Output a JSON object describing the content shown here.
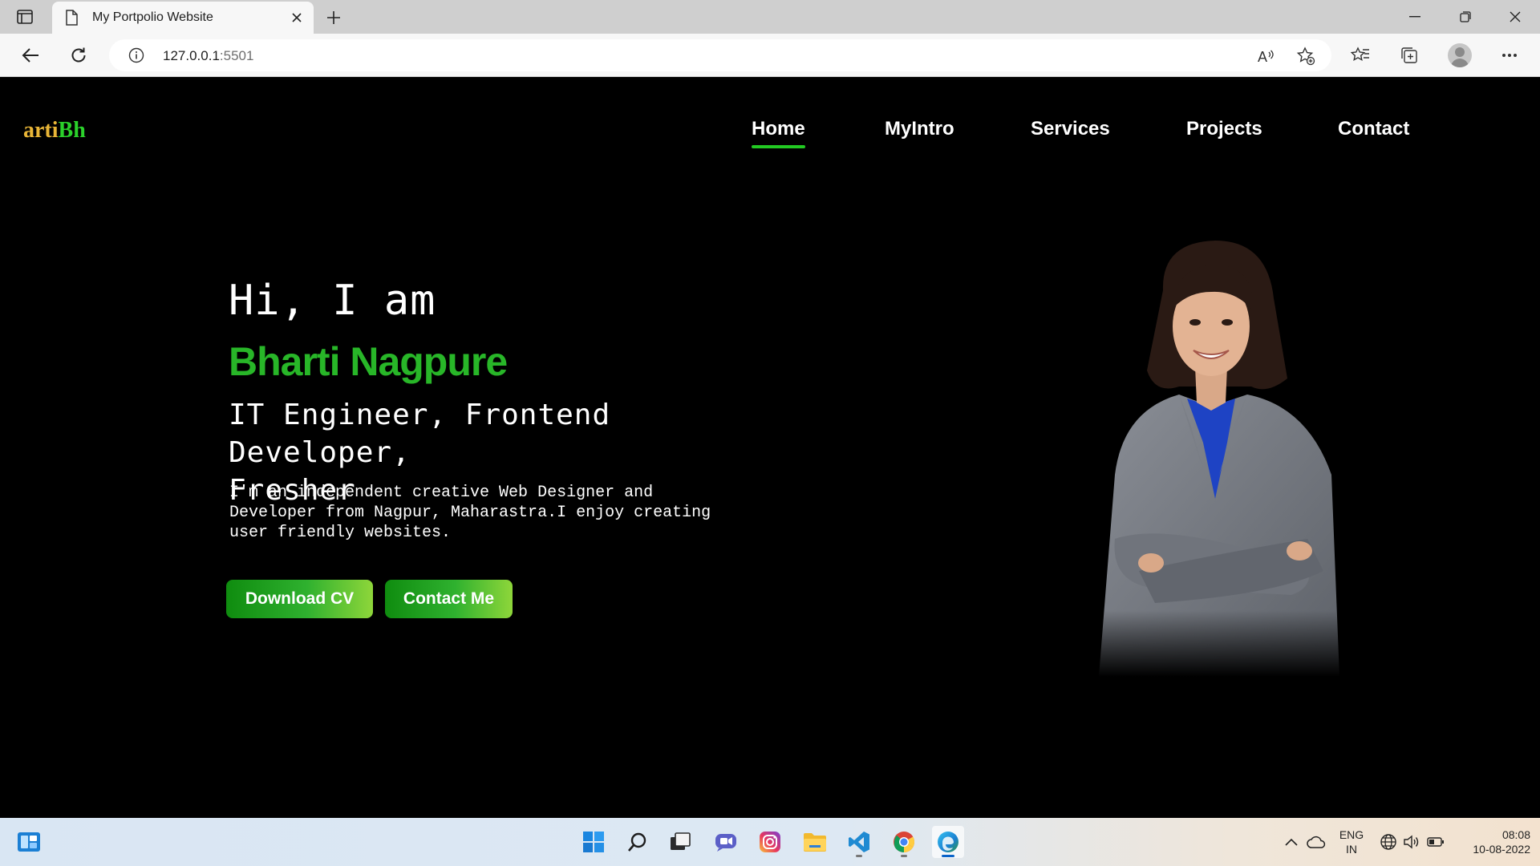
{
  "browser": {
    "tab_title": "My Portpolio Website",
    "url_host": "127.0.0.1",
    "url_port": ":5501"
  },
  "site": {
    "logo_part1": "arti",
    "logo_part2": "Bh",
    "nav": [
      "Home",
      "MyIntro",
      "Services",
      "Projects",
      "Contact"
    ],
    "active_nav": "Home",
    "greeting": "Hi, I am",
    "name": "Bharti Nagpure",
    "role_line1": "IT Engineer, Frontend Developer,",
    "role_line2": "Fresher",
    "bio_line1": "I'm an independent creative Web Designer and",
    "bio_line2": "Developer from Nagpur, Maharastra.I enjoy creating",
    "bio_line3": "user friendly websites.",
    "download_button": "Download CV",
    "contact_button": "Contact Me"
  },
  "taskbar": {
    "apps": [
      "start-icon",
      "search-icon",
      "task-view-icon",
      "chat-icon",
      "instagram-icon",
      "file-explorer-icon",
      "vscode-icon",
      "chrome-icon",
      "edge-icon"
    ],
    "lang_line1": "ENG",
    "lang_line2": "IN",
    "time": "08:08",
    "date": "10-08-2022"
  },
  "colors": {
    "accent_green": "#28b628",
    "logo_gold": "#e8b537",
    "page_background": "#000000"
  }
}
